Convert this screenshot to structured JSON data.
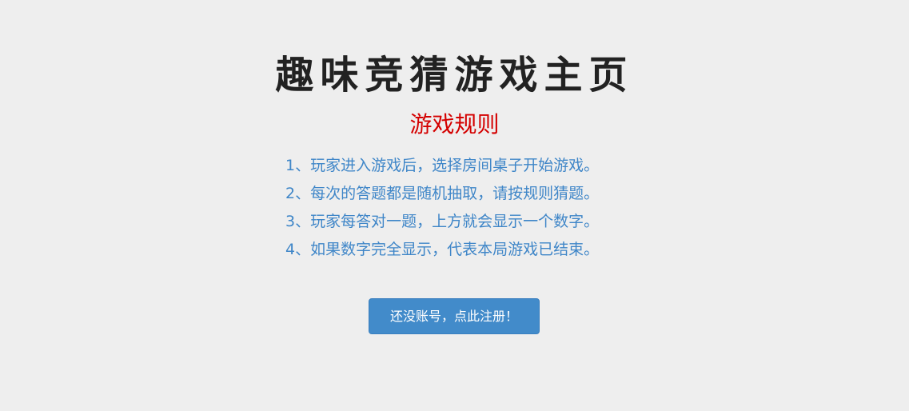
{
  "header": {
    "title": "趣味竞猜游戏主页",
    "subtitle": "游戏规则"
  },
  "rules": [
    "1、玩家进入游戏后，选择房间桌子开始游戏。",
    "2、每次的答题都是随机抽取，请按规则猜题。",
    "3、玩家每答对一题，上方就会显示一个数字。",
    "4、如果数字完全显示，代表本局游戏已结束。"
  ],
  "actions": {
    "register_label": "还没账号，点此注册！"
  },
  "colors": {
    "background": "#eeeeee",
    "title": "#222222",
    "subtitle": "#d40000",
    "rules_text": "#3f86c8",
    "button": "#428bca"
  }
}
